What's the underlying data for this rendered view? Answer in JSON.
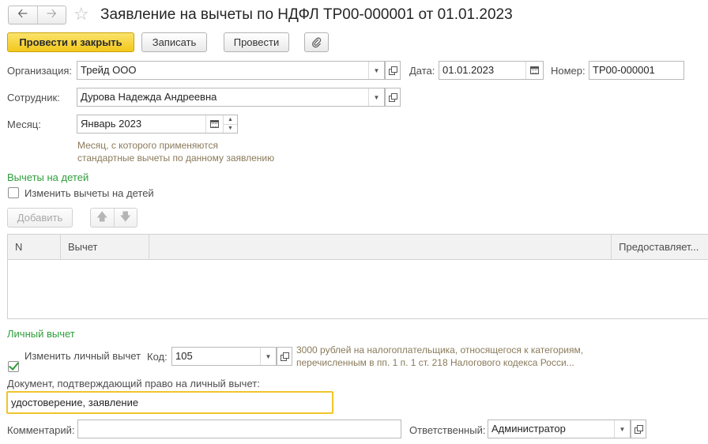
{
  "header": {
    "back_icon": "arrow-left-icon",
    "forward_icon": "arrow-right-icon",
    "favorite_icon": "star-icon",
    "title": "Заявление на вычеты по НДФЛ ТР00-000001 от 01.01.2023"
  },
  "toolbar": {
    "post_close_label": "Провести и закрыть",
    "save_label": "Записать",
    "post_label": "Провести",
    "attach_icon": "paperclip-icon"
  },
  "organization": {
    "label": "Организация:",
    "value": "Трейд ООО"
  },
  "date": {
    "label": "Дата:",
    "value": "01.01.2023"
  },
  "number": {
    "label": "Номер:",
    "value": "ТР00-000001"
  },
  "employee": {
    "label": "Сотрудник:",
    "value": "Дурова Надежда Андреевна"
  },
  "month": {
    "label": "Месяц:",
    "value": "Январь 2023",
    "hint_line1": "Месяц, с которого применяются",
    "hint_line2": "стандартные вычеты по данному заявлению"
  },
  "children": {
    "section_title": "Вычеты на детей",
    "change_label": "Изменить вычеты на детей",
    "change_checked": false,
    "add_label": "Добавить",
    "columns": [
      "N",
      "Вычет",
      "",
      "Предоставляет..."
    ]
  },
  "personal": {
    "section_title": "Личный вычет",
    "change_label": "Изменить личный вычет",
    "change_checked": true,
    "code_label": "Код:",
    "code_value": "105",
    "note_line1": "3000 рублей на налогоплательщика, относящегося к категориям,",
    "note_line2": "перечисленным в пп. 1 п. 1 ст. 218 Налогового кодекса Росси..."
  },
  "document": {
    "label": "Документ, подтверждающий право на личный вычет:",
    "value": "удостоверение, заявление"
  },
  "comment": {
    "label": "Комментарий:",
    "value": ""
  },
  "responsible": {
    "label": "Ответственный:",
    "value": "Администратор"
  },
  "colors": {
    "accent_yellow": "#f2c81b",
    "section_green": "#2e9e3b",
    "hint_brown": "#8a7a5a",
    "focus_border": "#f0c52a"
  }
}
